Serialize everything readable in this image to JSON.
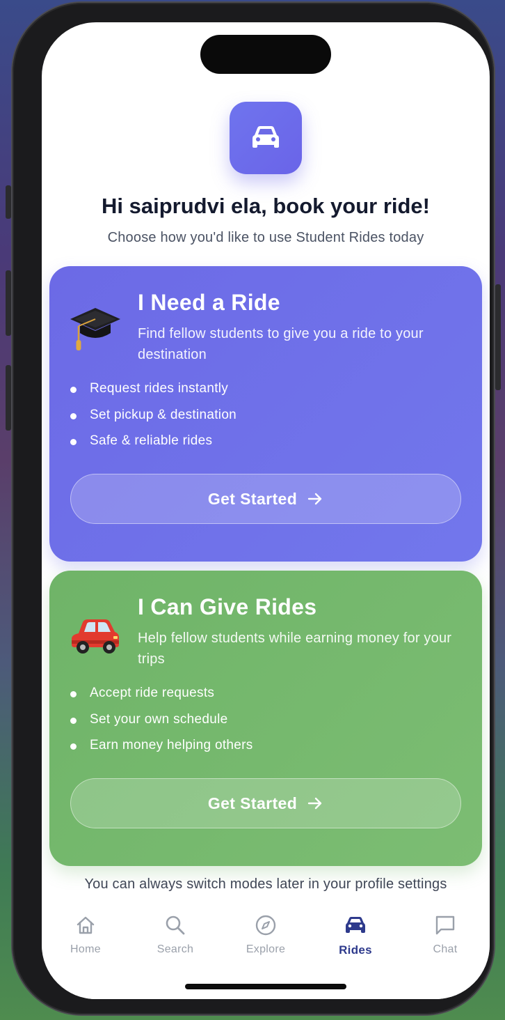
{
  "app": {
    "logo_icon": "car-icon",
    "accent_color": "#6c6ae6",
    "greeting": "Hi saiprudvi ela, book your ride!",
    "subtitle": "Choose how you'd like to use Student Rides today"
  },
  "cards": [
    {
      "id": "need-ride",
      "emoji_icon": "graduation-cap-icon",
      "title": "I Need a Ride",
      "description": "Find fellow students to give you a ride to your destination",
      "features": [
        "Request rides instantly",
        "Set pickup & destination",
        "Safe & reliable rides"
      ],
      "cta_label": "Get Started",
      "color": "#6c6ae6"
    },
    {
      "id": "give-rides",
      "emoji_icon": "red-car-icon",
      "title": "I Can Give Rides",
      "description": "Help fellow students while earning money for your trips",
      "features": [
        "Accept ride requests",
        "Set your own schedule",
        "Earn money helping others"
      ],
      "cta_label": "Get Started",
      "color": "#6fb468"
    }
  ],
  "footer_note": "You can always switch modes later in your profile settings",
  "tabbar": {
    "active": "Rides",
    "active_color": "#2e3a8c",
    "items": [
      {
        "label": "Home",
        "icon": "home-icon"
      },
      {
        "label": "Search",
        "icon": "search-icon"
      },
      {
        "label": "Explore",
        "icon": "compass-icon"
      },
      {
        "label": "Rides",
        "icon": "car-icon"
      },
      {
        "label": "Chat",
        "icon": "chat-icon"
      }
    ]
  }
}
